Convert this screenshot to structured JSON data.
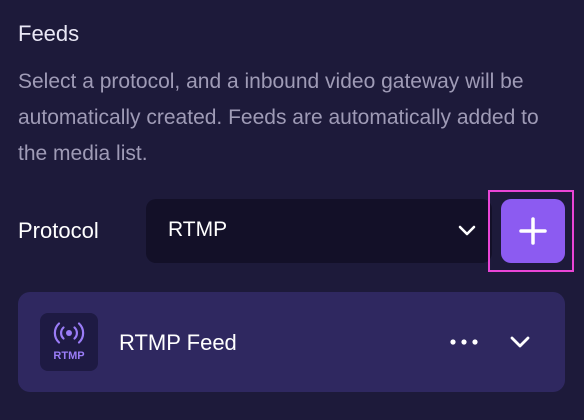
{
  "feeds": {
    "title": "Feeds",
    "description": "Select a protocol, and a inbound video gateway will be automatically created. Feeds are automatically added to the media list."
  },
  "protocol": {
    "label": "Protocol",
    "selected": "RTMP"
  },
  "feed_list": {
    "items": [
      {
        "name": "RTMP Feed",
        "icon_label": "RTMP",
        "icon": "broadcast-icon"
      }
    ]
  },
  "icons": {
    "add": "plus-icon",
    "select": "chevron-down-icon",
    "more": "more-horizontal-icon",
    "expand": "chevron-down-icon"
  },
  "colors": {
    "background": "#1d1a3a",
    "accent": "#8c5bf1",
    "card": "#2f2860",
    "highlight": "#e945d6"
  }
}
